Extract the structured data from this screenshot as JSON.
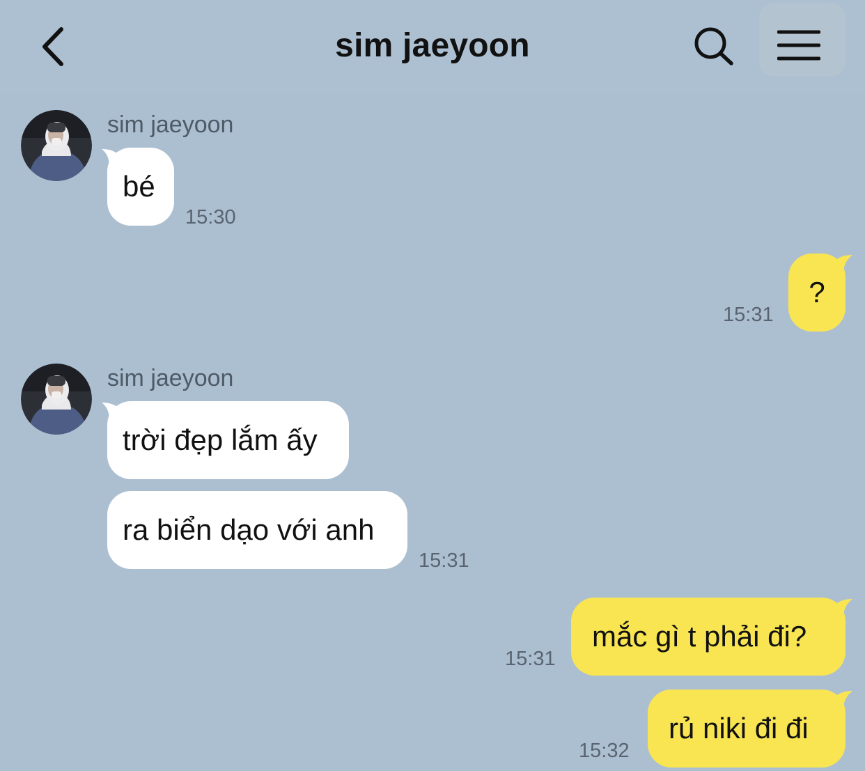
{
  "header": {
    "title": "sim jaeyoon",
    "back_icon": "chevron-left-icon",
    "search_icon": "search-icon",
    "menu_icon": "hamburger-menu-icon"
  },
  "colors": {
    "background": "#acbfd1",
    "incoming_bubble": "#ffffff",
    "outgoing_bubble": "#f9e552",
    "timestamp": "#5a6470"
  },
  "messages": [
    {
      "sender": "sim jaeyoon",
      "direction": "incoming",
      "text": "bé",
      "time": "15:30"
    },
    {
      "direction": "outgoing",
      "text": "?",
      "time": "15:31"
    },
    {
      "sender": "sim jaeyoon",
      "direction": "incoming",
      "text": "trời đẹp lắm ấy"
    },
    {
      "direction": "incoming",
      "text": "ra biển dạo với anh",
      "time": "15:31"
    },
    {
      "direction": "outgoing",
      "text": "mắc gì t phải đi?",
      "time": "15:31"
    },
    {
      "direction": "outgoing",
      "text": "rủ niki đi đi",
      "time": "15:32"
    }
  ]
}
